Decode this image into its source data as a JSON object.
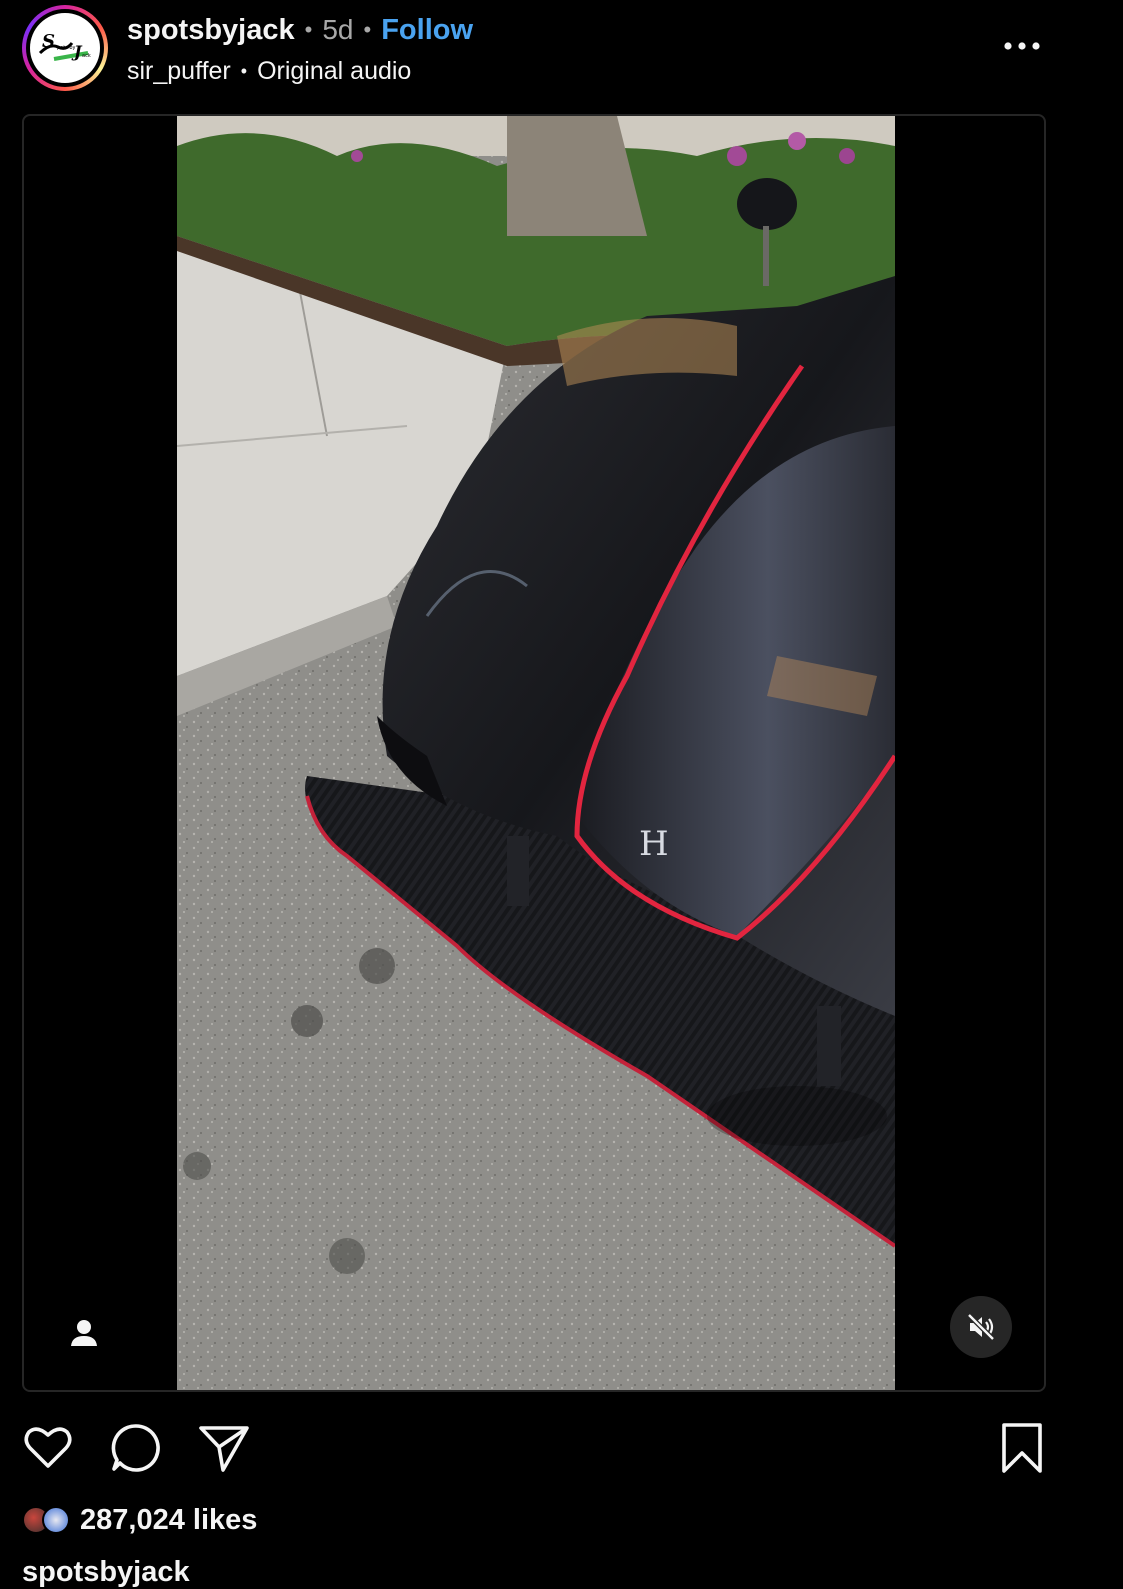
{
  "post": {
    "username": "spotsbyjack",
    "separator": "•",
    "time_ago": "5d",
    "follow_label": "Follow",
    "audio_user": "sir_puffer",
    "audio_label": "Original audio",
    "avatar_text": "Spots by Jack"
  },
  "media": {
    "type": "video",
    "muted": true,
    "badge_letter": "H"
  },
  "icons": {
    "more": "more-horizontal-icon",
    "tag": "user-tag-icon",
    "mute": "speaker-muted-icon",
    "like": "heart-icon",
    "comment": "comment-bubble-icon",
    "share": "paper-plane-icon",
    "save": "bookmark-icon"
  },
  "likes": {
    "count_label": "287,024 likes"
  },
  "caption": {
    "username": "spotsbyjack"
  },
  "colors": {
    "background": "#000000",
    "text": "#f5f5f5",
    "secondary": "#a8a8a8",
    "link": "#4aa3f0",
    "border": "#262626",
    "accent_red": "#e2253f"
  }
}
